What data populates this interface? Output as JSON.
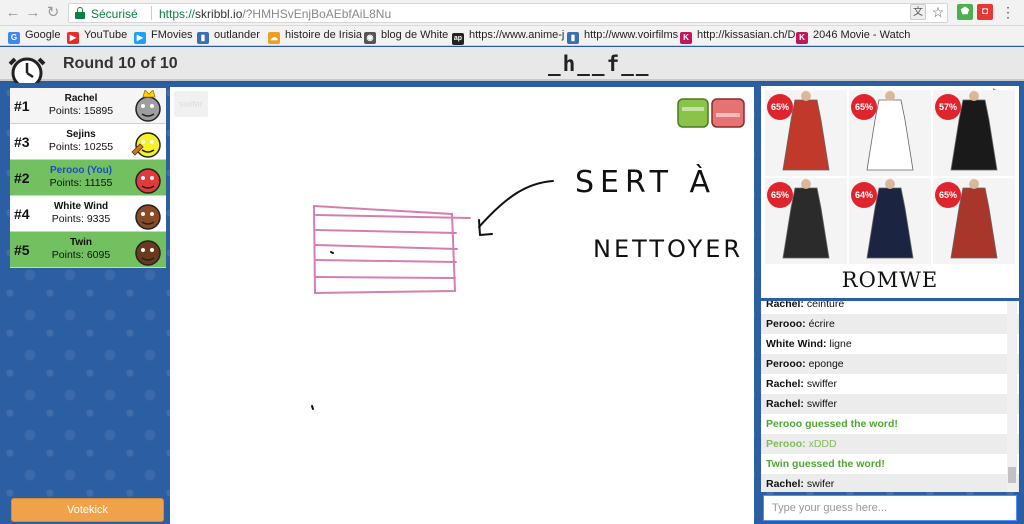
{
  "browser": {
    "secure_label": "Sécurisé",
    "url_scheme": "https://",
    "url_host": "skribbl.io",
    "url_path": "/?HMHSvEnjBoAEbfAiL8Nu",
    "bookmarks": [
      {
        "label": "Google",
        "color": "#4285f4",
        "icon": "G"
      },
      {
        "label": "YouTube",
        "color": "#e52d27",
        "icon": "▶"
      },
      {
        "label": "FMovies",
        "color": "#1ea1f2",
        "icon": "▶"
      },
      {
        "label": "outlander",
        "color": "#3a6fb0",
        "icon": "▮"
      },
      {
        "label": "histoire de Irisia",
        "color": "#f0a020",
        "icon": "☁"
      },
      {
        "label": "blog de White",
        "color": "#555555",
        "icon": "◉"
      },
      {
        "label": "https://www.anime-j",
        "color": "#222222",
        "icon": "ap"
      },
      {
        "label": "http://www.voirfilms",
        "color": "#3a6fb0",
        "icon": "▮"
      },
      {
        "label": "http://kissasian.ch/D",
        "color": "#c2185b",
        "icon": "K"
      },
      {
        "label": "2046 Movie - Watch",
        "color": "#c2185b",
        "icon": "K"
      }
    ]
  },
  "game": {
    "round_text": "Round 10 of 10",
    "word_hint": "_h__f__",
    "canvas_hint": "swifer"
  },
  "players": [
    {
      "rank": "#1",
      "name": "Rachel",
      "points": "Points: 15895",
      "is_you": false,
      "guessed": false,
      "avatar_color": "#9e9e9e",
      "crown": true
    },
    {
      "rank": "#3",
      "name": "Sejins",
      "points": "Points: 10255",
      "is_you": false,
      "guessed": false,
      "avatar_color": "#f4f02a",
      "crown": false,
      "drawing": true
    },
    {
      "rank": "#2",
      "name": "Perooo (You)",
      "points": "Points: 11155",
      "is_you": true,
      "guessed": true,
      "avatar_color": "#e23a3a",
      "crown": false
    },
    {
      "rank": "#4",
      "name": "White Wind",
      "points": "Points: 9335",
      "is_you": false,
      "guessed": false,
      "avatar_color": "#8a4a26",
      "crown": false
    },
    {
      "rank": "#5",
      "name": "Twin",
      "points": "Points: 6095",
      "is_you": false,
      "guessed": true,
      "avatar_color": "#6b3a1e",
      "crown": false
    }
  ],
  "drawing": {
    "word_line1": "SERT À",
    "word_line2": "NETTOYER",
    "stroke_color": "#d57fb0"
  },
  "ad": {
    "brand": "ROMWE",
    "items": [
      {
        "badge": "65%",
        "color": "#c0392b"
      },
      {
        "badge": "65%",
        "color": "#ffffff"
      },
      {
        "badge": "57%",
        "color": "#1a1a1a"
      },
      {
        "badge": "65%",
        "color": "#2b2b2b"
      },
      {
        "badge": "64%",
        "color": "#1b2440"
      },
      {
        "badge": "65%",
        "color": "#a8362a"
      }
    ]
  },
  "chat": {
    "messages": [
      {
        "user": "Rachel:",
        "text": "ceinture",
        "style": "normal"
      },
      {
        "user": "Perooo:",
        "text": "écrire",
        "style": "normal"
      },
      {
        "user": "White Wind:",
        "text": "ligne",
        "style": "normal"
      },
      {
        "user": "Perooo:",
        "text": "eponge",
        "style": "normal"
      },
      {
        "user": "Rachel:",
        "text": "swiffer",
        "style": "normal"
      },
      {
        "user": "Rachel:",
        "text": "swiffer",
        "style": "normal"
      },
      {
        "user": "",
        "text": "Perooo guessed the word!",
        "style": "green"
      },
      {
        "user": "Perooo:",
        "text": "xDDD",
        "style": "lightgreen"
      },
      {
        "user": "",
        "text": "Twin guessed the word!",
        "style": "green"
      },
      {
        "user": "Rachel:",
        "text": "swifer",
        "style": "normal"
      }
    ],
    "input_placeholder": "Type your guess here..."
  },
  "controls": {
    "votekick_label": "Votekick"
  }
}
